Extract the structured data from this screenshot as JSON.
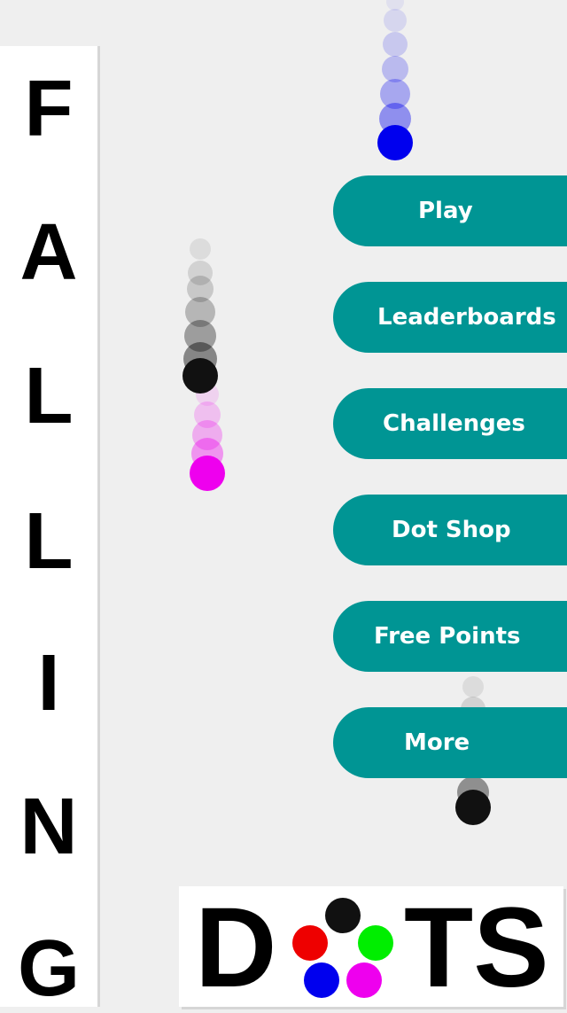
{
  "title": {
    "letters": [
      "F",
      "A",
      "L",
      "L",
      "I",
      "N",
      "G"
    ]
  },
  "menu": {
    "items": [
      {
        "label": "Play"
      },
      {
        "label": "Leaderboards"
      },
      {
        "label": "Challenges"
      },
      {
        "label": "Dot Shop"
      },
      {
        "label": "Free Points"
      },
      {
        "label": "More"
      }
    ]
  },
  "logo": {
    "left_text": "D",
    "right_text": "TS"
  },
  "colors": {
    "button_bg": "#009594",
    "button_text": "#ffffff",
    "background": "#efefef",
    "dot_blue": "#0000ee",
    "dot_magenta": "#ee00ee",
    "dot_black": "#111111",
    "dot_red": "#ee0000",
    "dot_green": "#00ee00"
  }
}
